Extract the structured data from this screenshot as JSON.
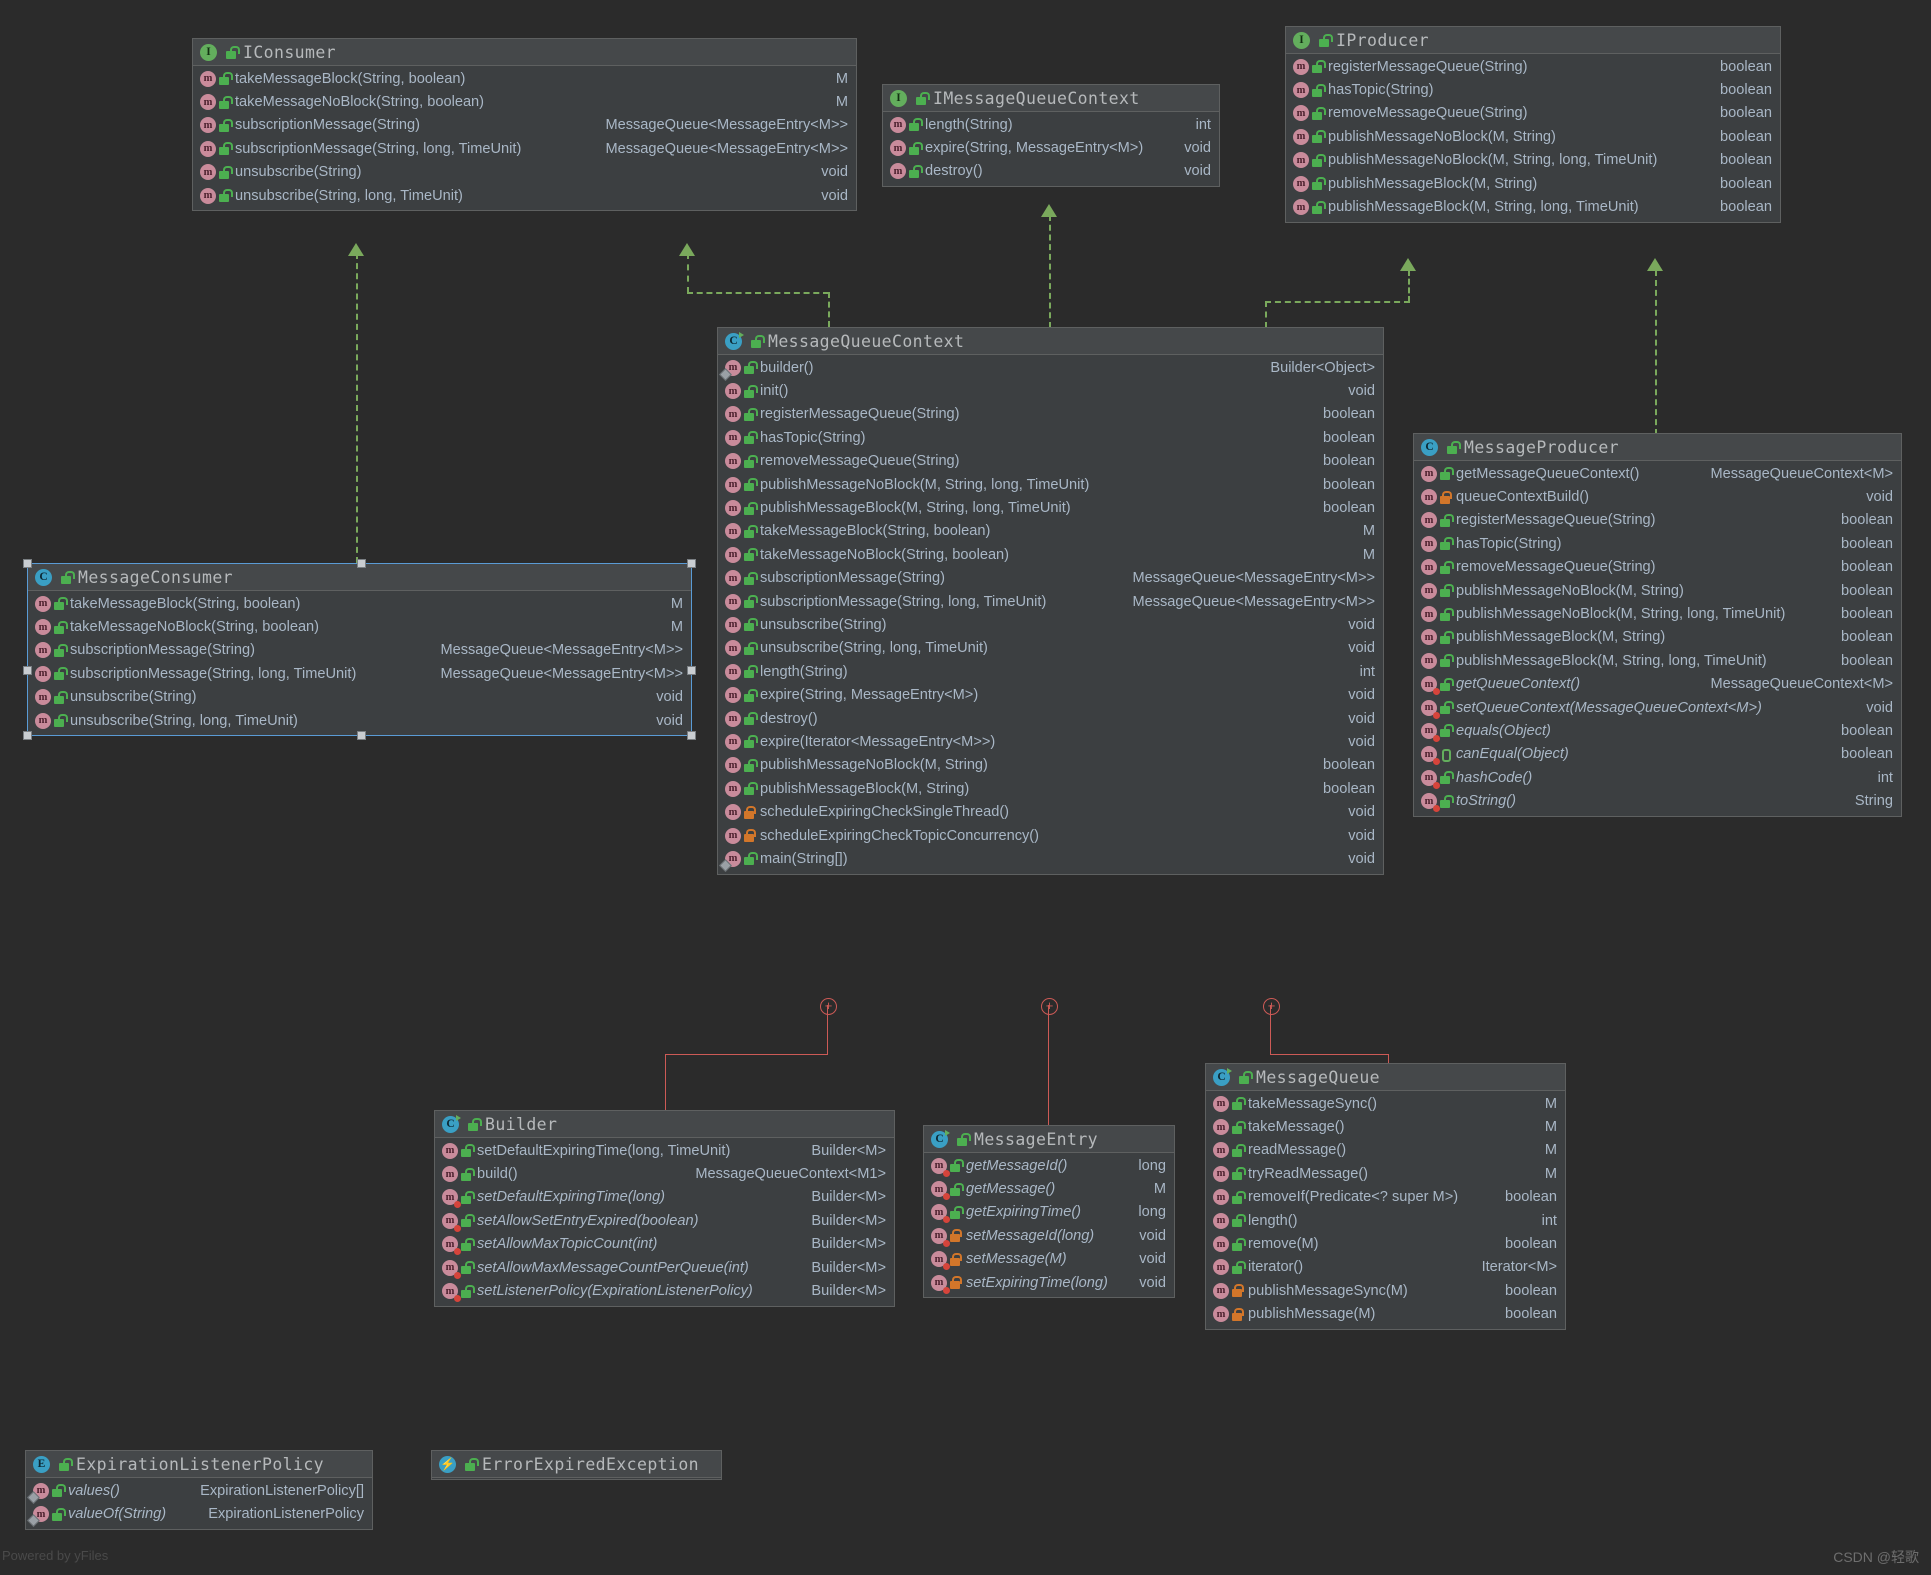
{
  "diagram": {
    "tool_watermark": "Powered by yFiles",
    "author_watermark": "CSDN @轻歌",
    "theme": {
      "background": "#2b2b2b",
      "box_bg": "#3c3f41",
      "header_bg": "#45484a",
      "text": "#a9b7c6",
      "inherit_line": "#7aa95c",
      "inner_class_line": "#cc5a56",
      "selection": "#5a9bd5"
    }
  },
  "classes": {
    "iconsumer": {
      "name": "IConsumer",
      "kind": "interface",
      "members": [
        {
          "sig": "takeMessageBlock(String, boolean)",
          "ret": "M",
          "vis": "pub",
          "italic": false
        },
        {
          "sig": "takeMessageNoBlock(String, boolean)",
          "ret": "M",
          "vis": "pub",
          "italic": false
        },
        {
          "sig": "subscriptionMessage(String)",
          "ret": "MessageQueue<MessageEntry<M>>",
          "vis": "pub",
          "italic": false
        },
        {
          "sig": "subscriptionMessage(String, long, TimeUnit)",
          "ret": "MessageQueue<MessageEntry<M>>",
          "vis": "pub",
          "italic": false
        },
        {
          "sig": "unsubscribe(String)",
          "ret": "void",
          "vis": "pub",
          "italic": false
        },
        {
          "sig": "unsubscribe(String, long, TimeUnit)",
          "ret": "void",
          "vis": "pub",
          "italic": false
        }
      ]
    },
    "imessagequeuecontext": {
      "name": "IMessageQueueContext",
      "kind": "interface",
      "members": [
        {
          "sig": "length(String)",
          "ret": "int",
          "vis": "pub",
          "italic": false
        },
        {
          "sig": "expire(String, MessageEntry<M>)",
          "ret": "void",
          "vis": "pub",
          "italic": false
        },
        {
          "sig": "destroy()",
          "ret": "void",
          "vis": "pub",
          "italic": false
        }
      ]
    },
    "iproducer": {
      "name": "IProducer",
      "kind": "interface",
      "members": [
        {
          "sig": "registerMessageQueue(String)",
          "ret": "boolean",
          "vis": "pub",
          "italic": false
        },
        {
          "sig": "hasTopic(String)",
          "ret": "boolean",
          "vis": "pub",
          "italic": false
        },
        {
          "sig": "removeMessageQueue(String)",
          "ret": "boolean",
          "vis": "pub",
          "italic": false
        },
        {
          "sig": "publishMessageNoBlock(M, String)",
          "ret": "boolean",
          "vis": "pub",
          "italic": false
        },
        {
          "sig": "publishMessageNoBlock(M, String, long, TimeUnit)",
          "ret": "boolean",
          "vis": "pub",
          "italic": false
        },
        {
          "sig": "publishMessageBlock(M, String)",
          "ret": "boolean",
          "vis": "pub",
          "italic": false
        },
        {
          "sig": "publishMessageBlock(M, String, long, TimeUnit)",
          "ret": "boolean",
          "vis": "pub",
          "italic": false
        }
      ]
    },
    "messageconsumer": {
      "name": "MessageConsumer",
      "kind": "class",
      "selected": true,
      "members": [
        {
          "sig": "takeMessageBlock(String, boolean)",
          "ret": "M",
          "vis": "pub",
          "italic": false
        },
        {
          "sig": "takeMessageNoBlock(String, boolean)",
          "ret": "M",
          "vis": "pub",
          "italic": false
        },
        {
          "sig": "subscriptionMessage(String)",
          "ret": "MessageQueue<MessageEntry<M>>",
          "vis": "pub",
          "italic": false
        },
        {
          "sig": "subscriptionMessage(String, long, TimeUnit)",
          "ret": "MessageQueue<MessageEntry<M>>",
          "vis": "pub",
          "italic": false
        },
        {
          "sig": "unsubscribe(String)",
          "ret": "void",
          "vis": "pub",
          "italic": false
        },
        {
          "sig": "unsubscribe(String, long, TimeUnit)",
          "ret": "void",
          "vis": "pub",
          "italic": false
        }
      ]
    },
    "messagequeuecontext": {
      "name": "MessageQueueContext",
      "kind": "class-inner",
      "members": [
        {
          "sig": "builder()",
          "ret": "Builder<Object>",
          "vis": "pub",
          "italic": false,
          "static": true
        },
        {
          "sig": "init()",
          "ret": "void",
          "vis": "pub",
          "italic": false
        },
        {
          "sig": "registerMessageQueue(String)",
          "ret": "boolean",
          "vis": "pub",
          "italic": false
        },
        {
          "sig": "hasTopic(String)",
          "ret": "boolean",
          "vis": "pub",
          "italic": false
        },
        {
          "sig": "removeMessageQueue(String)",
          "ret": "boolean",
          "vis": "pub",
          "italic": false
        },
        {
          "sig": "publishMessageNoBlock(M, String, long, TimeUnit)",
          "ret": "boolean",
          "vis": "pub",
          "italic": false
        },
        {
          "sig": "publishMessageBlock(M, String, long, TimeUnit)",
          "ret": "boolean",
          "vis": "pub",
          "italic": false
        },
        {
          "sig": "takeMessageBlock(String, boolean)",
          "ret": "M",
          "vis": "pub",
          "italic": false
        },
        {
          "sig": "takeMessageNoBlock(String, boolean)",
          "ret": "M",
          "vis": "pub",
          "italic": false
        },
        {
          "sig": "subscriptionMessage(String)",
          "ret": "MessageQueue<MessageEntry<M>>",
          "vis": "pub",
          "italic": false
        },
        {
          "sig": "subscriptionMessage(String, long, TimeUnit)",
          "ret": "MessageQueue<MessageEntry<M>>",
          "vis": "pub",
          "italic": false
        },
        {
          "sig": "unsubscribe(String)",
          "ret": "void",
          "vis": "pub",
          "italic": false
        },
        {
          "sig": "unsubscribe(String, long, TimeUnit)",
          "ret": "void",
          "vis": "pub",
          "italic": false
        },
        {
          "sig": "length(String)",
          "ret": "int",
          "vis": "pub",
          "italic": false
        },
        {
          "sig": "expire(String, MessageEntry<M>)",
          "ret": "void",
          "vis": "pub",
          "italic": false
        },
        {
          "sig": "destroy()",
          "ret": "void",
          "vis": "pub",
          "italic": false
        },
        {
          "sig": "expire(Iterator<MessageEntry<M>>)",
          "ret": "void",
          "vis": "pub",
          "italic": false
        },
        {
          "sig": "publishMessageNoBlock(M, String)",
          "ret": "boolean",
          "vis": "pub",
          "italic": false
        },
        {
          "sig": "publishMessageBlock(M, String)",
          "ret": "boolean",
          "vis": "pub",
          "italic": false
        },
        {
          "sig": "scheduleExpiringCheckSingleThread()",
          "ret": "void",
          "vis": "priv",
          "italic": false
        },
        {
          "sig": "scheduleExpiringCheckTopicConcurrency()",
          "ret": "void",
          "vis": "priv",
          "italic": false
        },
        {
          "sig": "main(String[])",
          "ret": "void",
          "vis": "pub",
          "italic": false,
          "static": true
        }
      ]
    },
    "messageproducer": {
      "name": "MessageProducer",
      "kind": "class",
      "members": [
        {
          "sig": "getMessageQueueContext()",
          "ret": "MessageQueueContext<M>",
          "vis": "pub",
          "italic": false
        },
        {
          "sig": "queueContextBuild()",
          "ret": "void",
          "vis": "priv",
          "italic": false
        },
        {
          "sig": "registerMessageQueue(String)",
          "ret": "boolean",
          "vis": "pub",
          "italic": false
        },
        {
          "sig": "hasTopic(String)",
          "ret": "boolean",
          "vis": "pub",
          "italic": false
        },
        {
          "sig": "removeMessageQueue(String)",
          "ret": "boolean",
          "vis": "pub",
          "italic": false
        },
        {
          "sig": "publishMessageNoBlock(M, String)",
          "ret": "boolean",
          "vis": "pub",
          "italic": false
        },
        {
          "sig": "publishMessageNoBlock(M, String, long, TimeUnit)",
          "ret": "boolean",
          "vis": "pub",
          "italic": false
        },
        {
          "sig": "publishMessageBlock(M, String)",
          "ret": "boolean",
          "vis": "pub",
          "italic": false
        },
        {
          "sig": "publishMessageBlock(M, String, long, TimeUnit)",
          "ret": "boolean",
          "vis": "pub",
          "italic": false
        },
        {
          "sig": "getQueueContext()",
          "ret": "MessageQueueContext<M>",
          "vis": "pub",
          "italic": true,
          "lombok": true
        },
        {
          "sig": "setQueueContext(MessageQueueContext<M>)",
          "ret": "void",
          "vis": "pub",
          "italic": true,
          "lombok": true
        },
        {
          "sig": "equals(Object)",
          "ret": "boolean",
          "vis": "pub",
          "italic": true,
          "lombok": true
        },
        {
          "sig": "canEqual(Object)",
          "ret": "boolean",
          "vis": "prot",
          "italic": true,
          "lombok": true
        },
        {
          "sig": "hashCode()",
          "ret": "int",
          "vis": "pub",
          "italic": true,
          "lombok": true
        },
        {
          "sig": "toString()",
          "ret": "String",
          "vis": "pub",
          "italic": true,
          "lombok": true
        }
      ]
    },
    "builder": {
      "name": "Builder",
      "kind": "class-inner",
      "members": [
        {
          "sig": "setDefaultExpiringTime(long, TimeUnit)",
          "ret": "Builder<M>",
          "vis": "pub",
          "italic": false
        },
        {
          "sig": "build()",
          "ret": "MessageQueueContext<M1>",
          "vis": "pub",
          "italic": false
        },
        {
          "sig": "setDefaultExpiringTime(long)",
          "ret": "Builder<M>",
          "vis": "pub",
          "italic": true,
          "lombok": true
        },
        {
          "sig": "setAllowSetEntryExpired(boolean)",
          "ret": "Builder<M>",
          "vis": "pub",
          "italic": true,
          "lombok": true
        },
        {
          "sig": "setAllowMaxTopicCount(int)",
          "ret": "Builder<M>",
          "vis": "pub",
          "italic": true,
          "lombok": true
        },
        {
          "sig": "setAllowMaxMessageCountPerQueue(int)",
          "ret": "Builder<M>",
          "vis": "pub",
          "italic": true,
          "lombok": true
        },
        {
          "sig": "setListenerPolicy(ExpirationListenerPolicy)",
          "ret": "Builder<M>",
          "vis": "pub",
          "italic": true,
          "lombok": true
        }
      ]
    },
    "messageentry": {
      "name": "MessageEntry",
      "kind": "class-inner",
      "members": [
        {
          "sig": "getMessageId()",
          "ret": "long",
          "vis": "pub",
          "italic": true,
          "lombok": true
        },
        {
          "sig": "getMessage()",
          "ret": "M",
          "vis": "pub",
          "italic": true,
          "lombok": true
        },
        {
          "sig": "getExpiringTime()",
          "ret": "long",
          "vis": "pub",
          "italic": true,
          "lombok": true
        },
        {
          "sig": "setMessageId(long)",
          "ret": "void",
          "vis": "priv",
          "italic": true,
          "lombok": true
        },
        {
          "sig": "setMessage(M)",
          "ret": "void",
          "vis": "priv",
          "italic": true,
          "lombok": true
        },
        {
          "sig": "setExpiringTime(long)",
          "ret": "void",
          "vis": "priv",
          "italic": true,
          "lombok": true
        }
      ]
    },
    "messagequeue": {
      "name": "MessageQueue",
      "kind": "class-inner",
      "members": [
        {
          "sig": "takeMessageSync()",
          "ret": "M",
          "vis": "pub",
          "italic": false
        },
        {
          "sig": "takeMessage()",
          "ret": "M",
          "vis": "pub",
          "italic": false
        },
        {
          "sig": "readMessage()",
          "ret": "M",
          "vis": "pub",
          "italic": false
        },
        {
          "sig": "tryReadMessage()",
          "ret": "M",
          "vis": "pub",
          "italic": false
        },
        {
          "sig": "removeIf(Predicate<? super M>)",
          "ret": "boolean",
          "vis": "pub",
          "italic": false
        },
        {
          "sig": "length()",
          "ret": "int",
          "vis": "pub",
          "italic": false
        },
        {
          "sig": "remove(M)",
          "ret": "boolean",
          "vis": "pub",
          "italic": false
        },
        {
          "sig": "iterator()",
          "ret": "Iterator<M>",
          "vis": "pub",
          "italic": false
        },
        {
          "sig": "publishMessageSync(M)",
          "ret": "boolean",
          "vis": "priv",
          "italic": false
        },
        {
          "sig": "publishMessage(M)",
          "ret": "boolean",
          "vis": "priv",
          "italic": false
        }
      ]
    },
    "expirationlistenerpolicy": {
      "name": "ExpirationListenerPolicy",
      "kind": "enum",
      "members": [
        {
          "sig": "values()",
          "ret": "ExpirationListenerPolicy[]",
          "vis": "pub",
          "italic": true,
          "static": true
        },
        {
          "sig": "valueOf(String)",
          "ret": "ExpirationListenerPolicy",
          "vis": "pub",
          "italic": true,
          "static": true
        }
      ]
    },
    "errorexpiredexception": {
      "name": "ErrorExpiredException",
      "kind": "annotation",
      "members": []
    }
  }
}
